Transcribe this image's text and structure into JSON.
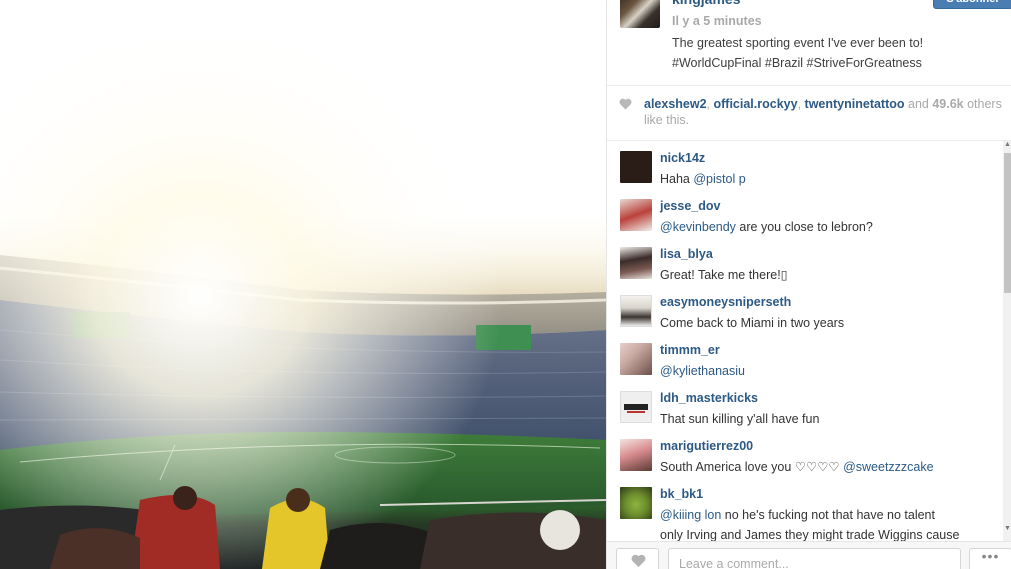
{
  "post": {
    "username": "kingjames",
    "follow_label": "S'abonner",
    "time_ago": "Il y a 5 minutes",
    "caption": "The greatest sporting event I've ever been to! #WorldCupFinal #Brazil #StriveForGreatness"
  },
  "likes": {
    "users": [
      "alexshew2",
      "official.rockyy",
      "twentyninetattoo"
    ],
    "sep1": ", ",
    "sep2": ", ",
    "and": " and ",
    "count": "49.6k",
    "suffix": " others like this."
  },
  "comments": [
    {
      "user": "nick14z",
      "mention": "@pistol",
      "text": "Haha ",
      "after": "      p",
      "avatar_color": "#2a1d18"
    },
    {
      "user": "jesse_dov",
      "mention": "@kevinbendy",
      "text": "",
      "after": " are you close to lebron?",
      "avatar_color": "#b9423a"
    },
    {
      "user": "lisa_blya",
      "mention": "",
      "text": "Great! Take me there!▯",
      "after": "",
      "avatar_color": "#3a2c2a"
    },
    {
      "user": "easymoneysniperseth",
      "mention": "",
      "text": "Come back to Miami in two years",
      "after": "",
      "avatar_color": "#d8d4cc"
    },
    {
      "user": "timmm_er",
      "mention": "@kyliethanasiu",
      "text": "",
      "after": "",
      "avatar_color": "#c7a8a0"
    },
    {
      "user": "ldh_masterkicks",
      "mention": "",
      "text": "That sun killing y'all have fun",
      "after": "",
      "avatar_color": "#efefef"
    },
    {
      "user": "marigutierrez00",
      "mention": "@sweetzzzcake",
      "text": "South America love you ♡♡♡♡ ",
      "after": "",
      "avatar_color": "#d98c8f"
    },
    {
      "user": "bk_bk1",
      "mention": "@kiiing  lon",
      "text": "",
      "after": " no he's fucking not that have no talent",
      "line2": "only Irving and James they might trade Wiggins cause",
      "avatar_color": "#6d8d2e"
    }
  ],
  "footer": {
    "comment_placeholder": "Leave a comment...",
    "more_label": "•••"
  },
  "colors": {
    "link": "#2c5a85",
    "muted": "#a9a9a9",
    "follow_button": "#4a7eb3"
  },
  "icons": {
    "like": "heart-icon",
    "more": "ellipsis-icon"
  }
}
